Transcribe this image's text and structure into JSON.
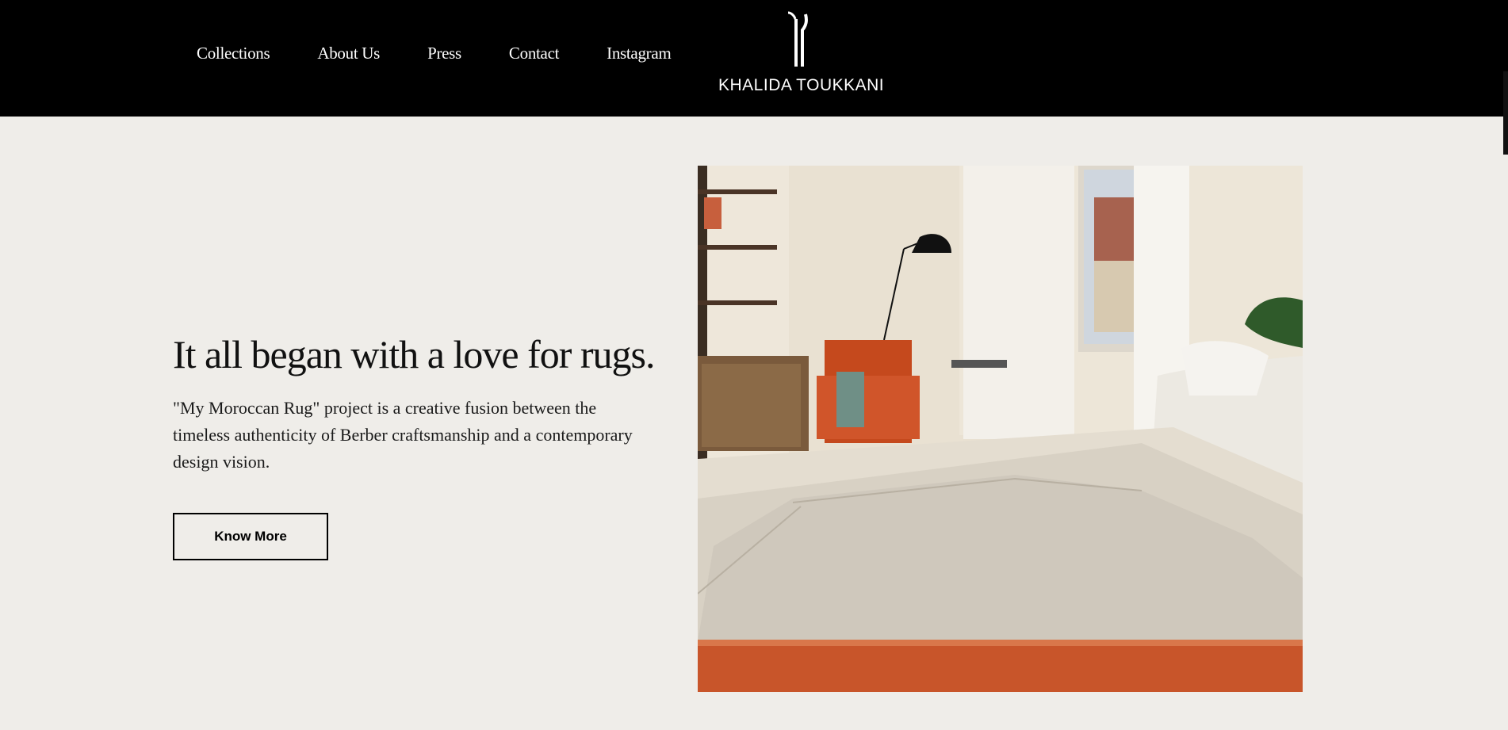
{
  "header": {
    "nav": [
      {
        "label": "Collections"
      },
      {
        "label": "About Us"
      },
      {
        "label": "Press"
      },
      {
        "label": "Contact"
      },
      {
        "label": "Instagram"
      }
    ],
    "logo": {
      "icon": "kt-monogram-icon",
      "brand": "KHALIDA TOUKKANI"
    }
  },
  "hero": {
    "title": "It all began with a love for rugs.",
    "text": "\"My Moroccan Rug\" project is a creative fusion between the timeless authenticity of Berber craftsmanship and a contemporary design vision.",
    "button_label": "Know More",
    "image": {
      "icon": "living-room-rug-photo"
    }
  },
  "colors": {
    "header_bg": "#000000",
    "page_bg": "#efede9",
    "text": "#111111",
    "accent_orange": "#c8552a"
  }
}
